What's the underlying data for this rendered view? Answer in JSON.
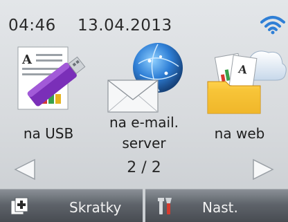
{
  "status": {
    "time": "04:46",
    "date": "13.04.2013"
  },
  "tiles": [
    {
      "label_lines": [
        "na USB"
      ]
    },
    {
      "label_lines": [
        "na e-mail.",
        "server"
      ]
    },
    {
      "label_lines": [
        "na web"
      ]
    }
  ],
  "pager": {
    "text": "2 / 2"
  },
  "bottom_bar": {
    "shortcuts_label": "Skratky",
    "settings_label": "Nast."
  },
  "icons": {
    "wifi": "wifi-icon",
    "usb": "usb-drive-icon",
    "email": "email-server-icon",
    "web": "web-cloud-icon",
    "prev": "arrow-left-icon",
    "next": "arrow-right-icon",
    "shortcuts": "add-shortcut-icon",
    "settings": "tools-icon"
  },
  "colors": {
    "accent_blue": "#2f7fd6",
    "usb_purple": "#7a2fb8",
    "bar_gray": "#5e636a"
  }
}
